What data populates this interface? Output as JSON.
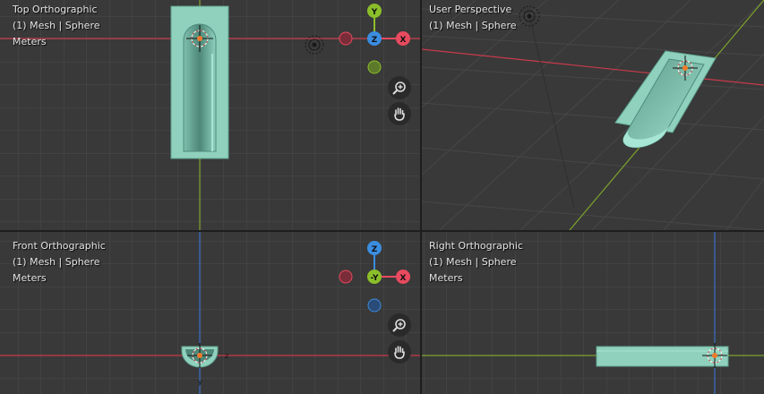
{
  "viewports": {
    "top": {
      "view_name": "Top Orthographic",
      "object_info": "(1) Mesh | Sphere",
      "units": "Meters"
    },
    "user": {
      "view_name": "User Perspective",
      "object_info": "(1) Mesh | Sphere"
    },
    "front": {
      "view_name": "Front Orthographic",
      "object_info": "(1) Mesh | Sphere",
      "units": "Meters"
    },
    "right": {
      "view_name": "Right Orthographic",
      "object_info": "(1) Mesh | Sphere",
      "units": "Meters"
    }
  },
  "gizmo_top": {
    "up": "Y",
    "center": "Z",
    "right": "X"
  },
  "gizmo_front": {
    "up": "Z",
    "center": "-Y",
    "right": "X"
  },
  "axis_labels": {
    "z": "z",
    "y": "y"
  },
  "colors": {
    "viewport_bg": "#393939",
    "grid": "#4a4a4a",
    "x_axis": "#c83a4a",
    "y_axis": "#7ea22c",
    "z_axis": "#3a6fc8",
    "mesh": "#8fd1bd",
    "gizmo_x": "#e84a5f",
    "gizmo_y": "#8bbf2a",
    "gizmo_z": "#3b8de0"
  },
  "icons": [
    "zoom-in-icon",
    "hand-pan-icon",
    "cursor-3d-icon",
    "light-icon"
  ]
}
